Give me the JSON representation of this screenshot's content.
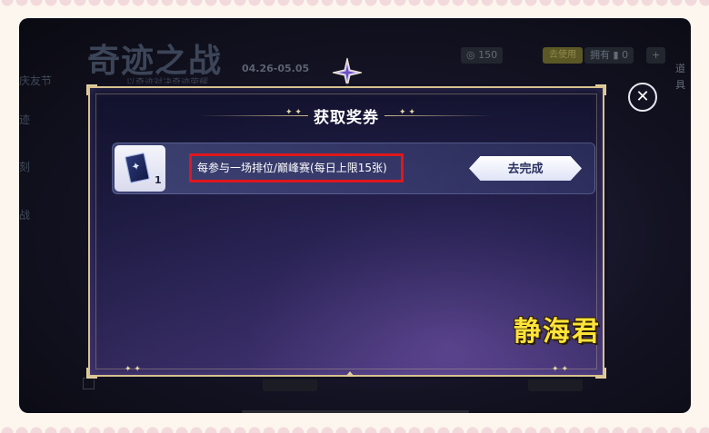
{
  "background": {
    "logo_text": "奇迹之战",
    "logo_sub": "以奇迹对决奇迹荣耀",
    "date_range": "04.26-05.05",
    "left_tabs": [
      "庆友节",
      "迹",
      "刻",
      "战"
    ],
    "currency_value": "150",
    "currency_badge": "去使用",
    "owned_label": "拥有",
    "owned_count": "0",
    "plus_label": "+",
    "right_label": "道具"
  },
  "dialog": {
    "title": "获取奖券",
    "close_icon": "close-x-icon",
    "tasks": [
      {
        "ticket_count": "1",
        "ticket_icon": "ticket-card-icon",
        "description": "每参与一场排位/巅峰赛(每日上限15张)",
        "action_label": "去完成"
      }
    ]
  },
  "watermark": "静海君",
  "colors": {
    "frame_gold": "#d8c28f",
    "highlight_red": "#e0161c",
    "watermark_yellow": "#ffe33a"
  }
}
